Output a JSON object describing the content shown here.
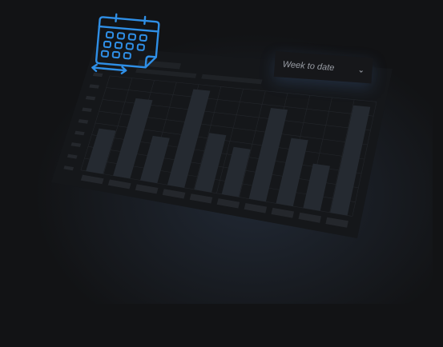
{
  "dropdown": {
    "selected": "Week to date",
    "icon": "chevron-down-icon"
  },
  "icons": {
    "calendar": "calendar-range-icon"
  },
  "colors": {
    "accent": "#2f8fe6",
    "bar": "#252a31",
    "panel": "#15171a",
    "background": "#121315"
  },
  "bars": [
    0.45,
    0.8,
    0.45,
    0.95,
    0.55,
    0.45,
    0.85,
    0.6,
    0.4,
    0.95
  ]
}
